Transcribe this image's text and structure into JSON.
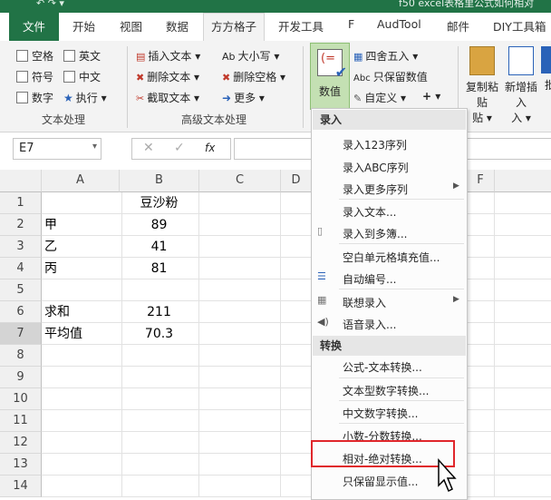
{
  "titlebar": {
    "title_fragment": "f50 excel表格里公式如何相对"
  },
  "tabs": [
    "文件",
    "开始",
    "视图",
    "数据",
    "方方格子",
    "开发工具",
    "F",
    "AudTool",
    "邮件",
    "DIY工具箱"
  ],
  "ribbon": {
    "text_group": {
      "items": [
        "空格",
        "英文",
        "符号",
        "中文",
        "数字",
        "执行"
      ],
      "label": "文本处理"
    },
    "adv_text_group": {
      "items": [
        "插入文本",
        "删除文本",
        "截取文本",
        "大小写",
        "删除空格",
        "更多"
      ],
      "label": "高级文本处理"
    },
    "numeric": {
      "big_button": "数值",
      "items": [
        "四舍五入",
        "只保留数值",
        "自定义"
      ]
    },
    "right_buttons": [
      "复制粘贴",
      "新增插入",
      "批"
    ]
  },
  "formula_bar": {
    "name_box": "E7",
    "fx": "fx"
  },
  "columns": [
    "A",
    "B",
    "C",
    "D",
    "E",
    "F"
  ],
  "rows": [
    {
      "n": "1",
      "a": "",
      "b": "豆沙粉"
    },
    {
      "n": "2",
      "a": "甲",
      "b": "89"
    },
    {
      "n": "3",
      "a": "乙",
      "b": "41"
    },
    {
      "n": "4",
      "a": "丙",
      "b": "81"
    },
    {
      "n": "5",
      "a": "",
      "b": ""
    },
    {
      "n": "6",
      "a": "求和",
      "b": "211"
    },
    {
      "n": "7",
      "a": "平均值",
      "b": "70.3"
    },
    {
      "n": "8",
      "a": "",
      "b": ""
    },
    {
      "n": "9",
      "a": "",
      "b": ""
    },
    {
      "n": "10",
      "a": "",
      "b": ""
    },
    {
      "n": "11",
      "a": "",
      "b": ""
    },
    {
      "n": "12",
      "a": "",
      "b": ""
    },
    {
      "n": "13",
      "a": "",
      "b": ""
    },
    {
      "n": "14",
      "a": "",
      "b": ""
    }
  ],
  "menu": {
    "section1": "录入",
    "items1": [
      "录入123序列",
      "录入ABC序列",
      "录入更多序列",
      "录入文本...",
      "录入到多簿...",
      "空白单元格填充值...",
      "自动编号...",
      "联想录入",
      "语音录入..."
    ],
    "section2": "转换",
    "items2": [
      "公式-文本转换...",
      "文本型数字转换...",
      "中文数字转换...",
      "小数-分数转换...",
      "相对-绝对转换...",
      "只保留显示值..."
    ]
  },
  "colors": {
    "excel_green": "#217346",
    "highlight_border": "#e0262b"
  }
}
